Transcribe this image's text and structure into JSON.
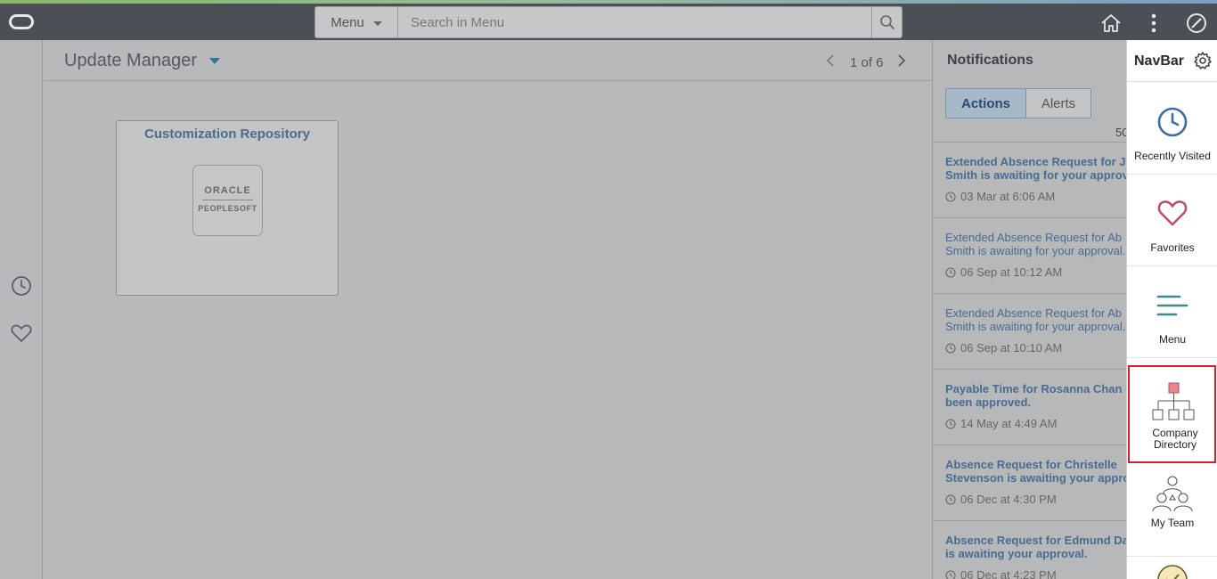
{
  "header": {
    "search_category": "Menu",
    "search_placeholder": "Search in Menu",
    "icons": [
      "oracle-logo",
      "search-icon",
      "home-icon",
      "more-vertical-icon",
      "compass-icon"
    ]
  },
  "left_rail": {
    "icons": [
      "recently-visited-icon",
      "favorites-icon"
    ]
  },
  "page": {
    "title": "Update Manager",
    "pager": "1 of 6"
  },
  "tile": {
    "title": "Customization Repository",
    "logo_line1": "ORACLE",
    "logo_line2": "PEOPLESOFT"
  },
  "notifications": {
    "title": "Notifications",
    "tabs": [
      "Actions",
      "Alerts"
    ],
    "count": "50",
    "items": [
      {
        "line1": "Extended Absence Request for Jo",
        "line2": "Smith is awaiting for your approval.",
        "time": "03 Mar at 6:06 AM",
        "bold": true
      },
      {
        "line1": "Extended Absence Request for Ab",
        "line2": "Smith is awaiting for your approval.",
        "time": "06 Sep at 10:12 AM",
        "bold": false
      },
      {
        "line1": "Extended Absence Request for Ab",
        "line2": "Smith is awaiting for your approval.",
        "time": "06 Sep at 10:10 AM",
        "bold": false
      },
      {
        "line1": "Payable Time for Rosanna Chan has",
        "line2": "been approved.",
        "time": "14 May at 4:49 AM",
        "bold": true
      },
      {
        "line1": "Absence Request for Christelle",
        "line2": "Stevenson is awaiting your approval.",
        "time": "06 Dec at 4:30 PM",
        "bold": true
      },
      {
        "line1": "Absence Request for Edmund Davis",
        "line2": "is awaiting your approval.",
        "time": "06 Dec at 4:23 PM",
        "bold": true
      }
    ]
  },
  "navbar": {
    "title": "NavBar",
    "items": [
      {
        "label": "Recently Visited"
      },
      {
        "label": "Favorites"
      },
      {
        "label": "Menu"
      },
      {
        "label1": "Company",
        "label2": "Directory"
      },
      {
        "label": "My Team"
      }
    ]
  },
  "colors": {
    "header_bg": "#4b5056",
    "link_blue": "#4a6b91",
    "highlight_red": "#d4202c",
    "clock_blue": "#3b6ea5",
    "heart_red": "#c0506a",
    "menu_teal": "#3b8b8b"
  }
}
